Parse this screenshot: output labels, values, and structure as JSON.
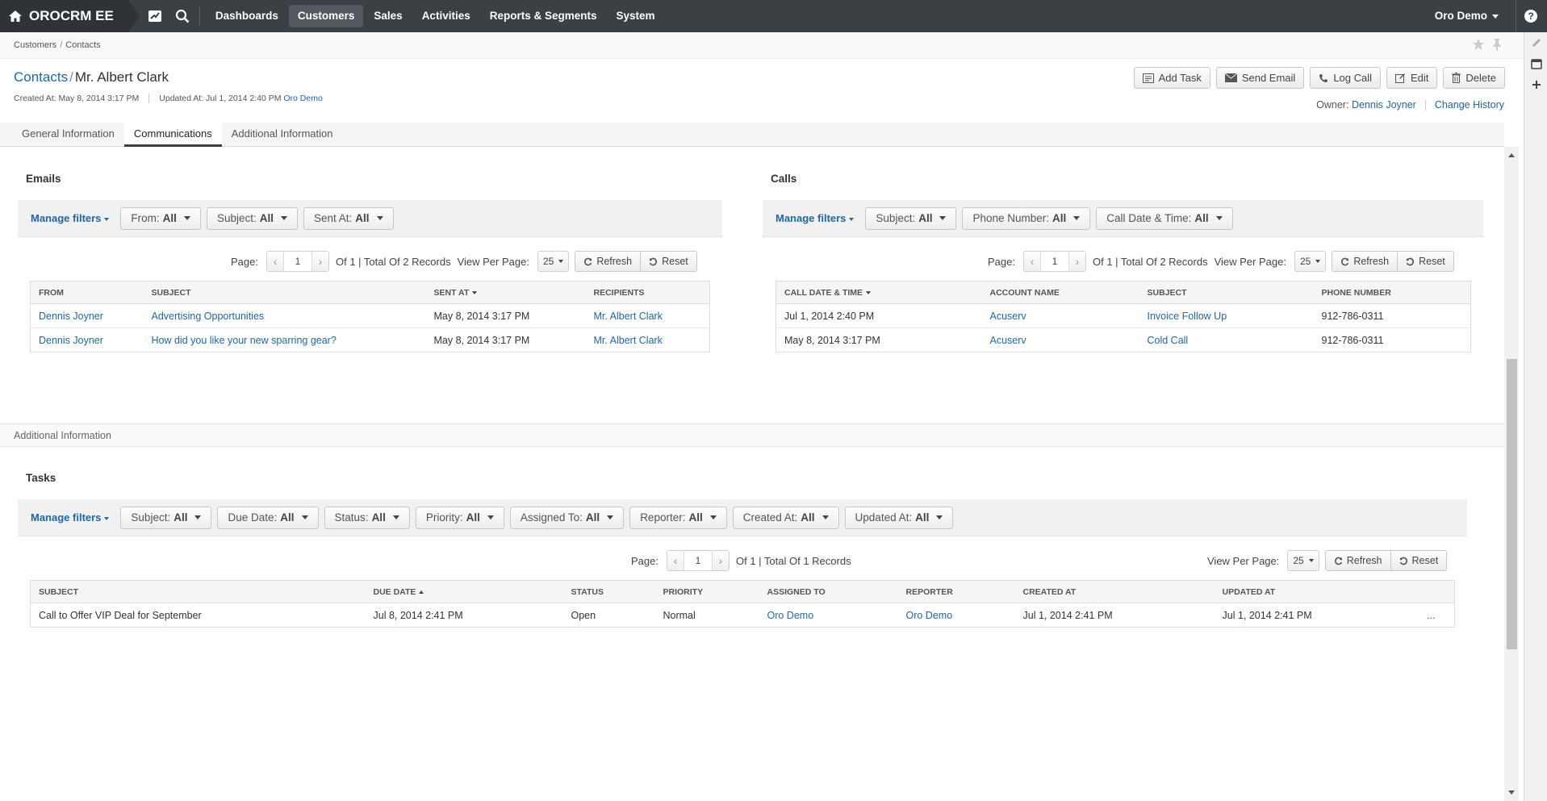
{
  "app": {
    "name": "OROCRM EE"
  },
  "nav": {
    "items": [
      "Dashboards",
      "Customers",
      "Sales",
      "Activities",
      "Reports & Segments",
      "System"
    ],
    "user": "Oro Demo",
    "help": "?"
  },
  "breadcrumb": {
    "parent": "Customers",
    "current": "Contacts"
  },
  "header": {
    "crumb": "Contacts",
    "name": "Mr. Albert Clark",
    "created_at": "Created At: May 8, 2014 3:17 PM",
    "updated_at": "Updated At: Jul 1, 2014 2:40 PM",
    "updated_by": "Oro Demo",
    "owner_label": "Owner:",
    "owner": "Dennis Joyner",
    "change_history": "Change History"
  },
  "actions": {
    "add_task": "Add Task",
    "send_email": "Send Email",
    "log_call": "Log Call",
    "edit": "Edit",
    "delete": "Delete"
  },
  "tabs": [
    "General Information",
    "Communications",
    "Additional Information"
  ],
  "common": {
    "manage_filters": "Manage filters",
    "page_label": "Page:",
    "page_num": "1",
    "view_per_page": "View Per Page:",
    "per_page": "25",
    "refresh": "Refresh",
    "reset": "Reset"
  },
  "emails": {
    "title": "Emails",
    "filters": [
      {
        "label": "From:",
        "value": "All"
      },
      {
        "label": "Subject:",
        "value": "All"
      },
      {
        "label": "Sent At:",
        "value": "All"
      }
    ],
    "pager_info": "Of 1 | Total Of 2 Records",
    "columns": [
      "From",
      "Subject",
      "Sent At",
      "Recipients"
    ],
    "rows": [
      {
        "from": "Dennis Joyner",
        "subject": "Advertising Opportunities",
        "sent_at": "May 8, 2014 3:17 PM",
        "recipients": "Mr. Albert Clark"
      },
      {
        "from": "Dennis Joyner",
        "subject": "How did you like your new sparring gear?",
        "sent_at": "May 8, 2014 3:17 PM",
        "recipients": "Mr. Albert Clark"
      }
    ]
  },
  "calls": {
    "title": "Calls",
    "filters": [
      {
        "label": "Subject:",
        "value": "All"
      },
      {
        "label": "Phone Number:",
        "value": "All"
      },
      {
        "label": "Call Date & Time:",
        "value": "All"
      }
    ],
    "pager_info": "Of 1 | Total Of 2 Records",
    "columns": [
      "Call Date & Time",
      "Account Name",
      "Subject",
      "Phone Number"
    ],
    "rows": [
      {
        "date": "Jul 1, 2014 2:40 PM",
        "account": "Acuserv",
        "subject": "Invoice Follow Up",
        "phone": "912-786-0311"
      },
      {
        "date": "May 8, 2014 3:17 PM",
        "account": "Acuserv",
        "subject": "Cold Call",
        "phone": "912-786-0311"
      }
    ]
  },
  "additional_information": "Additional Information",
  "tasks": {
    "title": "Tasks",
    "filters": [
      {
        "label": "Subject:",
        "value": "All"
      },
      {
        "label": "Due Date:",
        "value": "All"
      },
      {
        "label": "Status:",
        "value": "All"
      },
      {
        "label": "Priority:",
        "value": "All"
      },
      {
        "label": "Assigned To:",
        "value": "All"
      },
      {
        "label": "Reporter:",
        "value": "All"
      },
      {
        "label": "Created At:",
        "value": "All"
      },
      {
        "label": "Updated At:",
        "value": "All"
      }
    ],
    "pager_info": "Of 1 | Total Of 1 Records",
    "columns": [
      "Subject",
      "Due Date",
      "Status",
      "Priority",
      "Assigned To",
      "Reporter",
      "Created At",
      "Updated At"
    ],
    "rows": [
      {
        "subject": "Call to Offer VIP Deal for September",
        "due_date": "Jul 8, 2014 2:41 PM",
        "status": "Open",
        "priority": "Normal",
        "assigned_to": "Oro Demo",
        "reporter": "Oro Demo",
        "created_at": "Jul 1, 2014 2:41 PM",
        "updated_at": "Jul 1, 2014 2:41 PM",
        "more": "..."
      }
    ]
  }
}
